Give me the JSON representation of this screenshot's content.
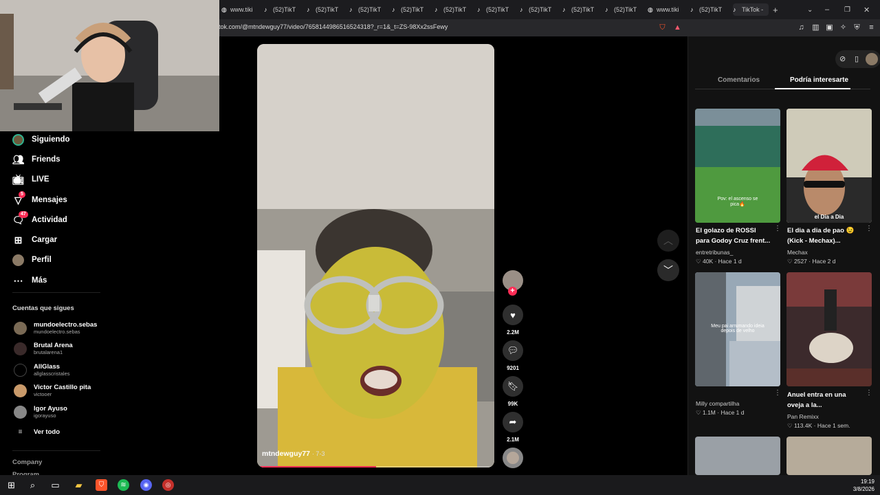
{
  "browser": {
    "tabs": [
      {
        "label": "www.tiki",
        "icon": "globe-icon"
      },
      {
        "label": "(52)TikT",
        "icon": "tiktok-icon"
      },
      {
        "label": "(52)TikT",
        "icon": "tiktok-icon"
      },
      {
        "label": "(52)TikT",
        "icon": "tiktok-icon"
      },
      {
        "label": "(52)TikT",
        "icon": "tiktok-icon"
      },
      {
        "label": "(52)TikT",
        "icon": "tiktok-icon"
      },
      {
        "label": "(52)TikT",
        "icon": "tiktok-icon"
      },
      {
        "label": "(52)TikT",
        "icon": "tiktok-icon"
      },
      {
        "label": "(52)TikT",
        "icon": "tiktok-icon"
      },
      {
        "label": "(52)TikT",
        "icon": "tiktok-icon"
      },
      {
        "label": "www.tiki",
        "icon": "globe-icon"
      },
      {
        "label": "(52)TikT",
        "icon": "tiktok-icon"
      },
      {
        "label": "TikTok -",
        "icon": "tiktok-icon"
      }
    ],
    "new_tab": "+",
    "url": "tok.com/@mtndewguy77/video/7658144986516524318?_r=1&_t=ZS-98Xx2ssFewy"
  },
  "sidebar": {
    "nav": [
      {
        "label": "Siguiendo",
        "icon": "avatar-icon",
        "badge": ""
      },
      {
        "label": "Friends",
        "icon": "friends-icon",
        "badge": ""
      },
      {
        "label": "LIVE",
        "icon": "live-icon",
        "badge": ""
      },
      {
        "label": "Mensajes",
        "icon": "messages-icon",
        "badge": "5"
      },
      {
        "label": "Actividad",
        "icon": "activity-icon",
        "badge": "47"
      },
      {
        "label": "Cargar",
        "icon": "upload-icon",
        "badge": ""
      },
      {
        "label": "Perfil",
        "icon": "profile-icon",
        "badge": ""
      },
      {
        "label": "Más",
        "icon": "more-icon",
        "badge": ""
      }
    ],
    "following_heading": "Cuentas que sigues",
    "accounts": [
      {
        "name": "mundoelectro.sebas",
        "handle": "mundoelectro.sebas"
      },
      {
        "name": "Brutal Arena",
        "handle": "brutalarena1"
      },
      {
        "name": "AllGlass",
        "handle": "allglasscristales"
      },
      {
        "name": "Victor Castillo pita",
        "handle": "victooer"
      },
      {
        "name": "Igor Ayuso",
        "handle": "igorayuso"
      }
    ],
    "see_all": "Ver todo",
    "company": "Company",
    "program": "Program"
  },
  "video": {
    "author": "mtndewguy77",
    "date": "· 7-3",
    "progress": 0.5
  },
  "actions": {
    "likes": "2.2M",
    "comments": "9201",
    "saves": "99K",
    "shares": "2.1M"
  },
  "right_panel": {
    "tabs": [
      "Comentarios",
      "Podría interesarte"
    ],
    "active_tab": 1,
    "cards": [
      {
        "title_line1": "El golazo de ROSSI",
        "title_line2": "para Godoy Cruz frent...",
        "author": "entretribunas_",
        "likes": "40K",
        "time": "Hace 1 d",
        "overlay": "Pov: el ascenso se pica🔥"
      },
      {
        "title_line1": "El dia a dia de pao 😉",
        "title_line2": "(Kick - Mechax)...",
        "author": "Mechax",
        "likes": "2527",
        "time": "Hace 2 d",
        "overlay": "el Dia a Dia"
      },
      {
        "title_line1": "",
        "title_line2": "",
        "author": "Milly compartilha",
        "likes": "1.1M",
        "time": "Hace 1 d",
        "overlay": "Meu pai arrumando ideia depois de velho"
      },
      {
        "title_line1": "Anuel entra en una",
        "title_line2": "oveja a la...",
        "author": "Pan Remixx",
        "likes": "113.4K",
        "time": "Hace 1 sem.",
        "overlay": ""
      }
    ]
  },
  "taskbar": {
    "time": "19:19",
    "date": "3/8/2026"
  },
  "colors": {
    "accent": "#fe2c55",
    "panel": "#121212"
  }
}
